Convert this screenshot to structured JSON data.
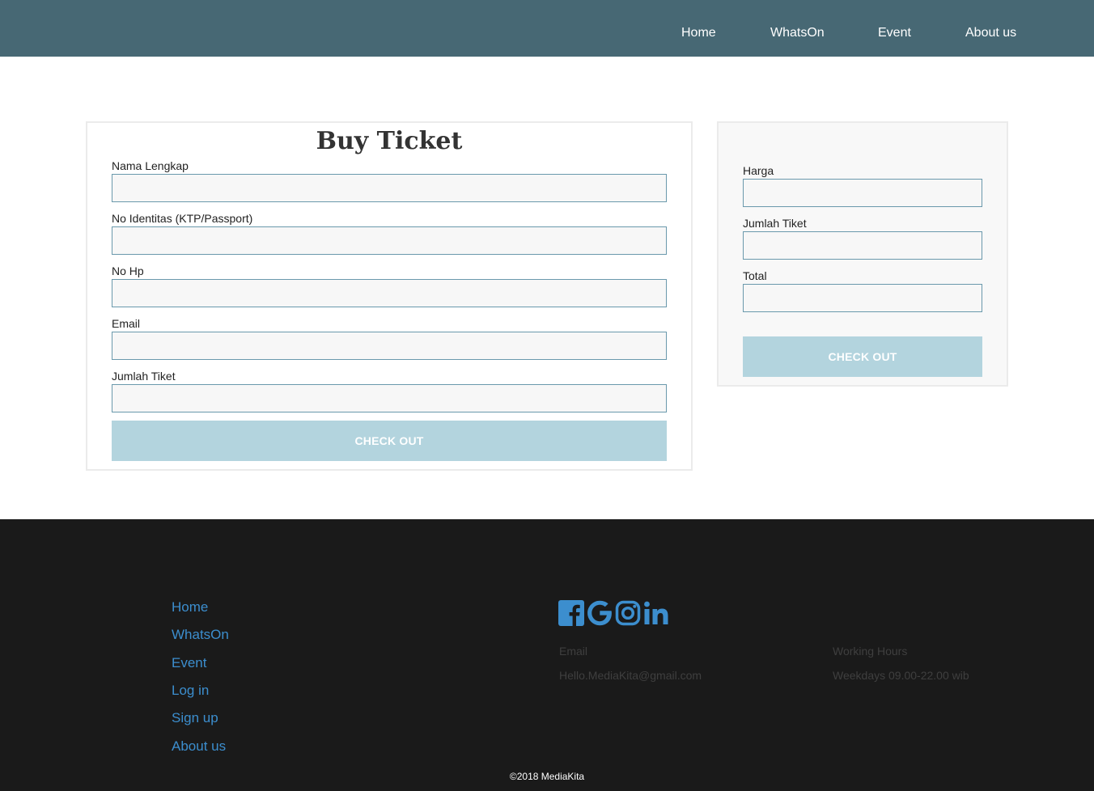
{
  "nav": {
    "items": [
      "Home",
      "WhatsOn",
      "Event",
      "About us"
    ]
  },
  "buy_form": {
    "title": "Buy Ticket",
    "fields": [
      {
        "label": "Nama Lengkap",
        "value": ""
      },
      {
        "label": "No Identitas (KTP/Passport)",
        "value": ""
      },
      {
        "label": "No Hp",
        "value": ""
      },
      {
        "label": "Email",
        "value": ""
      },
      {
        "label": "Jumlah Tiket",
        "value": ""
      }
    ],
    "button": "CHECK OUT"
  },
  "summary": {
    "fields": [
      {
        "label": "Harga",
        "value": ""
      },
      {
        "label": "Jumlah Tiket",
        "value": ""
      },
      {
        "label": "Total",
        "value": ""
      }
    ],
    "button": "CHECK OUT"
  },
  "footer": {
    "links": [
      "Home",
      "WhatsOn",
      "Event",
      "Log in",
      "Sign up",
      "About us"
    ],
    "social_icons": [
      "facebook-icon",
      "google-icon",
      "instagram-icon",
      "linkedin-icon"
    ],
    "email_label": "Email",
    "email_value": "Hello.MediaKita@gmail.com",
    "hours_label": "Working Hours",
    "hours_value": "Weekdays 09.00-22.00 wib",
    "copyright": "©2018 MediaKita"
  },
  "colors": {
    "navbar": "#476874",
    "button": "#b3d4de",
    "footer": "#1a1a1a",
    "footer_link": "#3c8ece"
  }
}
